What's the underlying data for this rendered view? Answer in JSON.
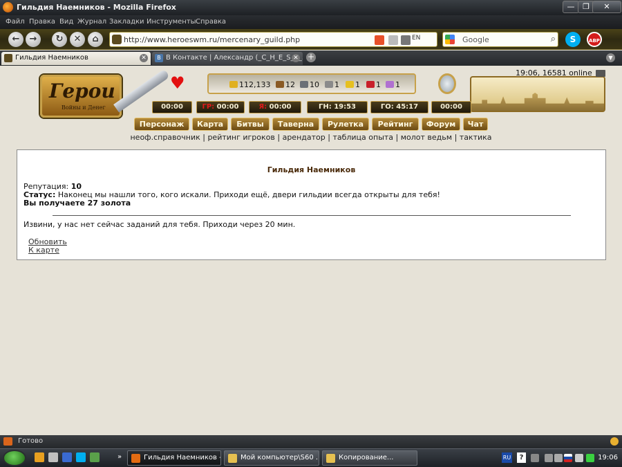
{
  "window": {
    "title": "Гильдия Наемников - Mozilla Firefox"
  },
  "menu": [
    "Файл",
    "Правка",
    "Вид",
    "Журнал",
    "Закладки",
    "Инструменты",
    "Справка"
  ],
  "nav": {
    "url": "http://www.heroeswm.ru/mercenary_guild.php",
    "search_placeholder": "Google",
    "abp_label": "ABP",
    "lang_label": "EN"
  },
  "tabs": [
    {
      "label": "Гильдия Наемников",
      "active": true
    },
    {
      "label": "В Контакте | Александр (_C_H_E_S_T_...",
      "active": false
    }
  ],
  "game": {
    "logo_title": "Герои",
    "logo_subtitle": "Войны и Денег",
    "clock": "19:06, 16581 online",
    "resources": [
      {
        "name": "gold",
        "value": "112,133",
        "color": "#e0b020"
      },
      {
        "name": "wood",
        "value": "12",
        "color": "#8a5a24"
      },
      {
        "name": "ore",
        "value": "10",
        "color": "#6a6f76"
      },
      {
        "name": "mercury",
        "value": "1",
        "color": "#8a8a8a"
      },
      {
        "name": "sulfur",
        "value": "1",
        "color": "#e6c020"
      },
      {
        "name": "crystal",
        "value": "1",
        "color": "#c8202a"
      },
      {
        "name": "gems",
        "value": "1",
        "color": "#b070d0"
      }
    ],
    "timers": [
      {
        "prefix": "",
        "value": "00:00"
      },
      {
        "prefix": "ГР:",
        "value": "00:00",
        "red": true
      },
      {
        "prefix": "Я:",
        "value": "00:00",
        "red": true
      },
      {
        "prefix": "ГН:",
        "value": "19:53"
      },
      {
        "prefix": "ГО:",
        "value": "45:17"
      },
      {
        "prefix": "",
        "value": "00:00"
      }
    ],
    "nav_buttons": [
      "Персонаж",
      "Карта",
      "Битвы",
      "Таверна",
      "Рулетка",
      "Рейтинг",
      "Форум",
      "Чат"
    ],
    "sublinks": [
      "неоф.справочник",
      "рейтинг игроков",
      "арендатор",
      "таблица опыта",
      "молот ведьм",
      "тактика"
    ],
    "separator": " | "
  },
  "main": {
    "title": "Гильдия Наемников",
    "reputation_label": "Репутация:",
    "reputation_value": "10",
    "status_label": "Статус:",
    "status_text": "Наконец мы нашли того, кого искали. Приходи ещё, двери гильдии всегда открыты для тебя!",
    "reward_text": "Вы получаете 27 золота",
    "no_tasks_text": "Извини, у нас нет сейчас заданий для тебя. Приходи через 20 мин.",
    "links": [
      "Обновить",
      "К карте"
    ]
  },
  "statusbar": {
    "text": "Готово"
  },
  "taskbar": {
    "tasks": [
      {
        "label": "Гильдия Наемников -...",
        "active": true
      },
      {
        "label": "Мой компьютер\\S60 ...",
        "active": false
      },
      {
        "label": "Копирование...",
        "active": false
      }
    ],
    "lang": "RU",
    "help": "?",
    "time": "19:06"
  }
}
